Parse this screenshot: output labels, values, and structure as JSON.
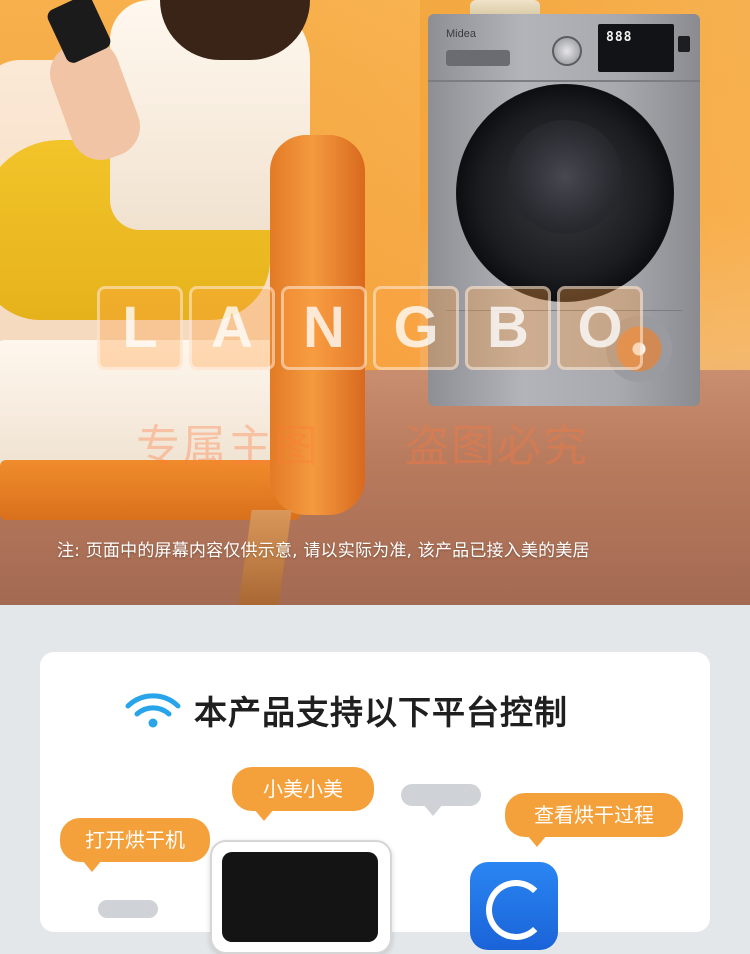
{
  "hero": {
    "dryer_brand": "Midea",
    "dryer_display": "888",
    "watermark_letters": [
      "L",
      "A",
      "N",
      "G",
      "B",
      "O"
    ],
    "watermark_text_left": "专属主图",
    "watermark_text_right": "盗图必究",
    "note": "注: 页面中的屏幕内容仅供示意, 请以实际为准, 该产品已接入美的美居"
  },
  "platform_card": {
    "title": "本产品支持以下平台控制",
    "icon": "wifi-icon",
    "bubbles": {
      "open_dryer": "打开烘干机",
      "xiaomei": "小美小美",
      "view_process": "查看烘干过程"
    },
    "colors": {
      "accent_orange": "#f5a13b",
      "wifi_blue": "#27a4ea",
      "app_blue": "#1f74e6"
    }
  }
}
